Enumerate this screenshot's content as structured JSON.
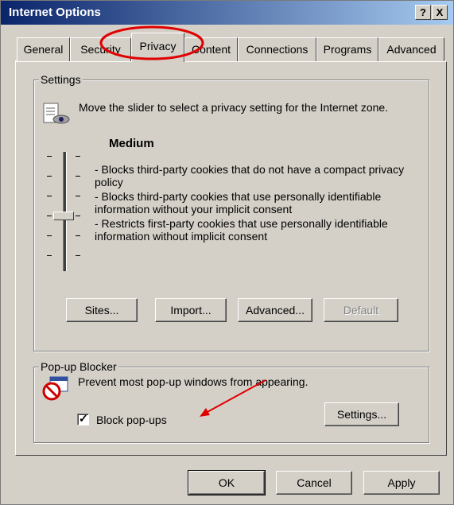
{
  "window": {
    "title": "Internet Options",
    "help_button": "?",
    "close_button": "X"
  },
  "tabs": [
    "General",
    "Security",
    "Privacy",
    "Content",
    "Connections",
    "Programs",
    "Advanced"
  ],
  "active_tab": "Privacy",
  "settings": {
    "group_label": "Settings",
    "icon": "privacy-zone-icon",
    "description": "Move the slider to select a privacy setting for the Internet zone.",
    "level": "Medium",
    "slider_level_fraction": 0.5,
    "bullets": [
      "- Blocks third-party cookies that do not have a compact privacy policy",
      "- Blocks third-party cookies that use personally identifiable information without your implicit consent",
      "- Restricts first-party cookies that use personally identifiable information without implicit consent"
    ],
    "buttons": {
      "sites": "Sites...",
      "import": "Import...",
      "advanced": "Advanced...",
      "default": "Default"
    }
  },
  "popup_blocker": {
    "group_label": "Pop-up Blocker",
    "icon": "popup-blocker-icon",
    "description": "Prevent most pop-up windows from appearing.",
    "checkbox_label": "Block pop-ups",
    "checked": true,
    "settings_button": "Settings..."
  },
  "footer": {
    "ok": "OK",
    "cancel": "Cancel",
    "apply": "Apply"
  },
  "annotations": {
    "highlight_color": "#e00000",
    "arrow_color": "#e00000"
  }
}
